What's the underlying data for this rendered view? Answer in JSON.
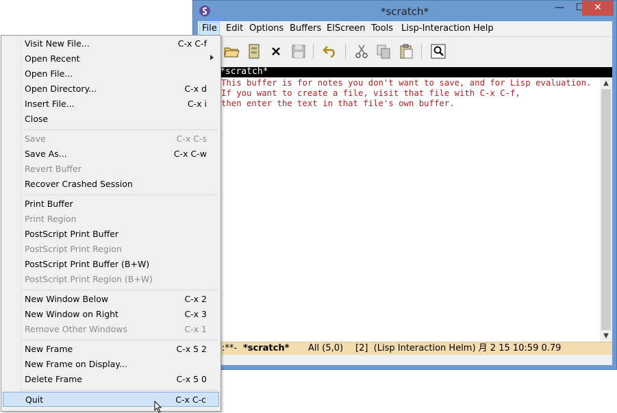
{
  "window": {
    "title": "*scratch*",
    "min_glyph": "—",
    "max_glyph": "☐",
    "close_glyph": "✕"
  },
  "menubar": [
    "File",
    "Edit",
    "Options",
    "Buffers",
    "ElScreen",
    "Tools",
    "Lisp-Interaction",
    "Help"
  ],
  "toolbar_icons": [
    "new-file-icon",
    "open-folder-icon",
    "open-directory-icon",
    "close-buffer-icon",
    "save-icon",
    "undo-icon",
    "cut-icon",
    "copy-icon",
    "paste-icon",
    "search-icon"
  ],
  "buffer_top_label": "*scratch*",
  "editor_lines": [
    "This buffer is for notes you don't want to save, and for Lisp evaluation.",
    "If you want to create a file, visit that file with C-x C-f,",
    "then enter the text in that file's own buffer."
  ],
  "modeline": {
    "status": ":**-",
    "buffer": "*scratch*",
    "position": "All (5,0)",
    "modes": "[2]  (Lisp Interaction Helm) 月 2 15 10:59 0.79"
  },
  "file_menu": [
    {
      "label": "Visit New File...",
      "accel": "C-x C-f",
      "enabled": true
    },
    {
      "label": "Open Recent",
      "accel": "",
      "enabled": true,
      "submenu": true
    },
    {
      "label": "Open File...",
      "accel": "",
      "enabled": true
    },
    {
      "label": "Open Directory...",
      "accel": "C-x d",
      "enabled": true
    },
    {
      "label": "Insert File...",
      "accel": "C-x i",
      "enabled": true
    },
    {
      "label": "Close",
      "accel": "",
      "enabled": true
    },
    {
      "label": "Save",
      "accel": "C-x C-s",
      "enabled": false
    },
    {
      "label": "Save As...",
      "accel": "C-x C-w",
      "enabled": true
    },
    {
      "label": "Revert Buffer",
      "accel": "",
      "enabled": false
    },
    {
      "label": "Recover Crashed Session",
      "accel": "",
      "enabled": true
    },
    {
      "label": "Print Buffer",
      "accel": "",
      "enabled": true
    },
    {
      "label": "Print Region",
      "accel": "",
      "enabled": false
    },
    {
      "label": "PostScript Print Buffer",
      "accel": "",
      "enabled": true
    },
    {
      "label": "PostScript Print Region",
      "accel": "",
      "enabled": false
    },
    {
      "label": "PostScript Print Buffer (B+W)",
      "accel": "",
      "enabled": true
    },
    {
      "label": "PostScript Print Region (B+W)",
      "accel": "",
      "enabled": false
    },
    {
      "label": "New Window Below",
      "accel": "C-x 2",
      "enabled": true
    },
    {
      "label": "New Window on Right",
      "accel": "C-x 3",
      "enabled": true
    },
    {
      "label": "Remove Other Windows",
      "accel": "C-x 1",
      "enabled": false
    },
    {
      "label": "New Frame",
      "accel": "C-x 5 2",
      "enabled": true
    },
    {
      "label": "New Frame on Display...",
      "accel": "",
      "enabled": true
    },
    {
      "label": "Delete Frame",
      "accel": "C-x 5 0",
      "enabled": true
    },
    {
      "label": "Quit",
      "accel": "C-x C-c",
      "enabled": true,
      "highlighted": true
    }
  ],
  "colors": {
    "title_bar": "#6c9bd2",
    "modeline": "#f3dcb0",
    "comment_text": "#b22222",
    "menu_highlight": "#d1e3f7"
  }
}
